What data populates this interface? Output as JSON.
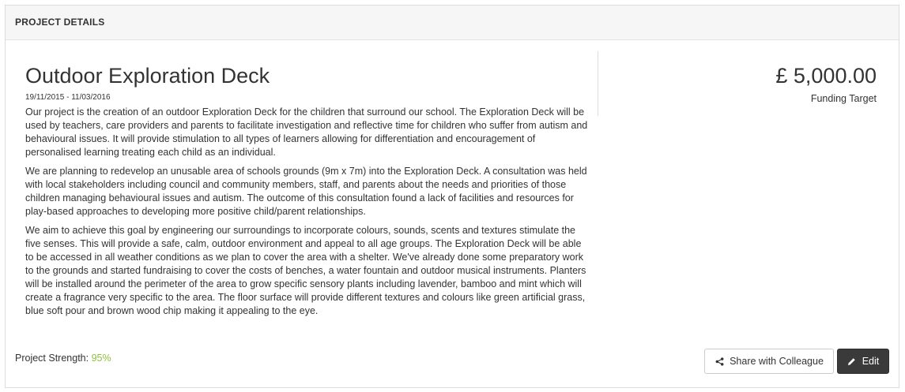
{
  "panel": {
    "title": "PROJECT DETAILS"
  },
  "project": {
    "title": "Outdoor Exploration Deck",
    "dates": "19/11/2015 - 11/03/2016",
    "paragraphs": [
      "Our project is the creation of an outdoor Exploration Deck for the children that surround our school. The Exploration Deck will be used by teachers, care providers and parents to facilitate investigation and reflective time for children who suffer from autism and behavioural issues. It will provide stimulation to all types of learners allowing for differentiation and encouragement of personalised learning treating each child as an individual.",
      "We are planning to redevelop an unusable area of schools grounds (9m x 7m) into the Exploration Deck. A consultation was held with local stakeholders including council and community members, staff, and parents about the needs and priorities of those children managing behavioural issues and autism. The outcome of this consultation found a lack of facilities and resources for play-based approaches to developing more positive child/parent relationships.",
      "We aim to achieve this goal by engineering our surroundings to incorporate colours, sounds, scents and textures stimulate the five senses. This will provide a safe, calm, outdoor environment and appeal to all age groups. The Exploration Deck will be able to be accessed in all weather conditions as we plan to cover the area with a shelter. We've already done some preparatory work to the grounds and started fundraising to cover the costs of benches, a water fountain and outdoor musical instruments. Planters will be installed around the perimeter of the area to grow specific sensory plants including lavender, bamboo and mint which will create a fragrance very specific to the area. The floor surface will provide different textures and colours like green artificial grass, blue soft pour and brown wood chip making it appealing to the eye."
    ]
  },
  "funding": {
    "amount": "£ 5,000.00",
    "label": "Funding Target"
  },
  "footer": {
    "strength_label": "Project Strength: ",
    "strength_value": "95%",
    "share_label": "Share with Colleague",
    "edit_label": "Edit"
  },
  "colors": {
    "strength_accent": "#8fbf3f",
    "edit_button_bg": "#3a3a3a"
  },
  "icons": {
    "share": "share-icon",
    "edit": "pencil-icon"
  }
}
